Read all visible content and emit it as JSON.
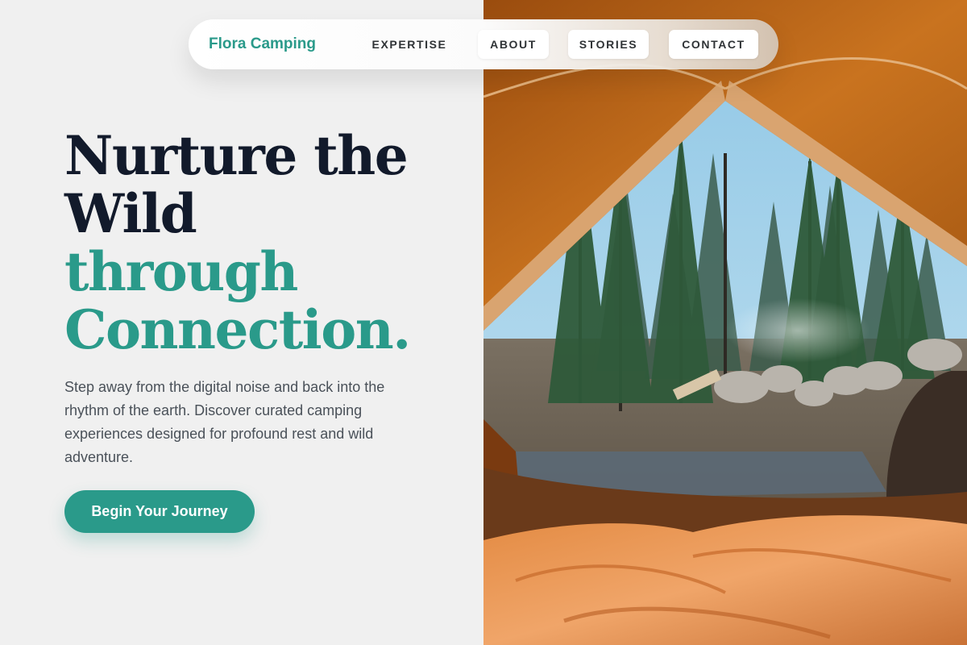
{
  "nav": {
    "brand": "Flora Camping",
    "links": [
      {
        "label": "EXPERTISE"
      },
      {
        "label": "ABOUT"
      },
      {
        "label": "STORIES"
      },
      {
        "label": "CONTACT"
      }
    ]
  },
  "hero": {
    "headline_line_1": "Nurture the",
    "headline_line_2": "Wild",
    "headline_line_3": "through",
    "headline_line_4": "Connection.",
    "intro": "Step away from the digital noise and back into the rhythm of the earth. Discover curated camping experiences designed for profound rest and wild adventure.",
    "cta_label": "Begin Your Journey"
  },
  "colors": {
    "accent": "#2a9a8a",
    "headline_dark": "#121a2b",
    "page_background": "#f0f0f0"
  }
}
